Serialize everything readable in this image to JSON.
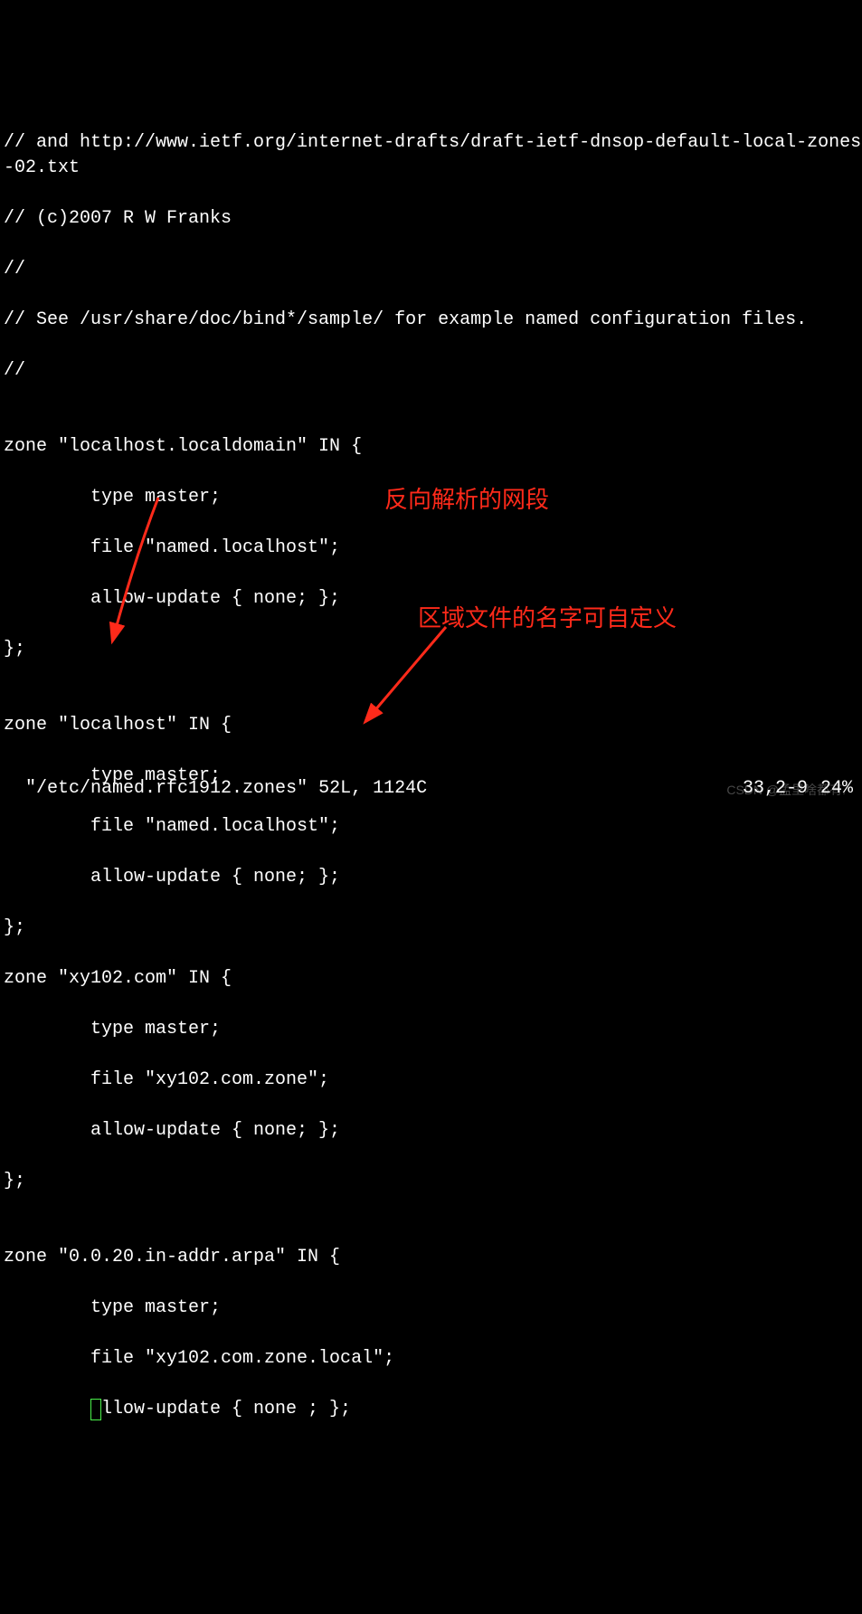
{
  "code": {
    "l1": "// and http://www.ietf.org/internet-drafts/draft-ietf-dnsop-default-local-zones-02.txt",
    "l2": "// (c)2007 R W Franks",
    "l3": "//",
    "l4": "// See /usr/share/doc/bind*/sample/ for example named configuration files.",
    "l5": "//",
    "l6": "",
    "l7": "zone \"localhost.localdomain\" IN {",
    "l8": "        type master;",
    "l9": "        file \"named.localhost\";",
    "l10": "        allow-update { none; };",
    "l11": "};",
    "l12": "",
    "l13": "zone \"localhost\" IN {",
    "l14": "        type master;",
    "l15": "        file \"named.localhost\";",
    "l16": "        allow-update { none; };",
    "l17": "};",
    "l18": "zone \"xy102.com\" IN {",
    "l19": "        type master;",
    "l20": "        file \"xy102.com.zone\";",
    "l21": "        allow-update { none; };",
    "l22": "};",
    "l23": "",
    "l24": "zone \"0.0.20.in-addr.arpa\" IN {",
    "l25": "        type master;",
    "l26": "        file \"xy102.com.zone.local\";",
    "l27_pre": "        ",
    "l27_cursor_char": "a",
    "l27_post": "llow-update { none ; };"
  },
  "annotations": {
    "a1": "反向解析的网段",
    "a2": "区域文件的名字可自定义"
  },
  "status": {
    "filename": "\"/etc/named.rfc1912.zones\" 52L, 1124C",
    "position": "33,2-9",
    "percent": "24%"
  },
  "watermark": "CSDN @孟里啥都有."
}
